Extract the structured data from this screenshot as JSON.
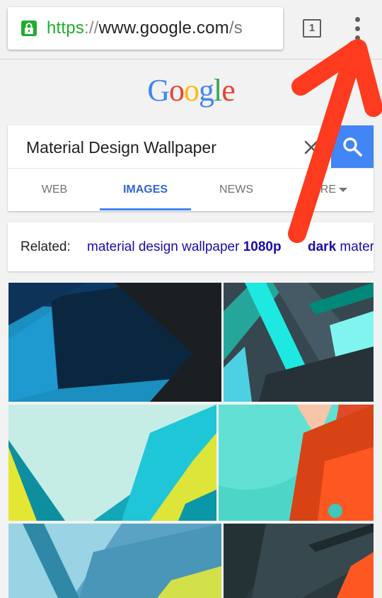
{
  "browser": {
    "url_scheme": "https",
    "url_separator": "://",
    "url_host": "www.google.com",
    "url_rest": "/s",
    "tab_count": "1"
  },
  "logo": {
    "letters": [
      "G",
      "o",
      "o",
      "g",
      "l",
      "e"
    ]
  },
  "search": {
    "query": "Material Design Wallpaper"
  },
  "tabs": [
    {
      "label": "WEB"
    },
    {
      "label": "IMAGES"
    },
    {
      "label": "NEWS"
    },
    {
      "label": "MORE"
    }
  ],
  "related": {
    "label": "Related:",
    "items": [
      {
        "prefix": "material design wallpaper ",
        "bold": "1080p"
      },
      {
        "prefix": "",
        "bold": "dark",
        "suffix": " material"
      }
    ]
  },
  "colors": {
    "accent": "#4285f4",
    "secure": "#1fae2e",
    "annotation_arrow": "#ff3b1f",
    "link": "#1a0dab"
  }
}
